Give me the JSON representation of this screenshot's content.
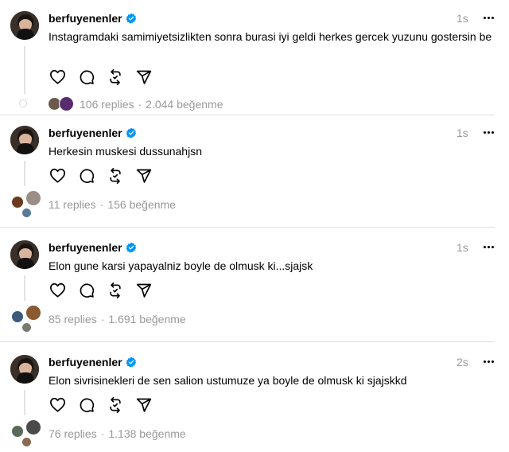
{
  "posts": [
    {
      "username": "berfuyenenler",
      "time": "1s",
      "text": "Instagramdaki samimiyetsizlikten sonra burasi iyi geldi herkes gercek yuzunu gostersin be",
      "replies": "106 replies",
      "likes": "2.044 beğenme",
      "separator": "·"
    },
    {
      "username": "berfuyenenler",
      "time": "1s",
      "text": "Herkesin muskesi dussunahjsn",
      "replies": "11 replies",
      "likes": "156 beğenme",
      "separator": "·"
    },
    {
      "username": "berfuyenenler",
      "time": "1s",
      "text": "Elon gune karsi yapayalniz boyle de olmusk ki...sjajsk",
      "replies": "85 replies",
      "likes": "1.691 beğenme",
      "separator": "·"
    },
    {
      "username": "berfuyenenler",
      "time": "2s",
      "text": "Elon sivrisinekleri de sen salion ustumuze ya boyle de olmusk ki sjajskkd",
      "replies": "76 replies",
      "likes": "1.138 beğenme",
      "separator": "·"
    }
  ],
  "icons": {
    "like": "heart-icon",
    "reply": "comment-icon",
    "repost": "repost-icon",
    "share": "send-icon",
    "verified": "verified-badge-icon",
    "more": "more-icon"
  },
  "colors": {
    "verified": "#0095f6",
    "muted": "#999999",
    "divider": "#e0e0e0"
  }
}
